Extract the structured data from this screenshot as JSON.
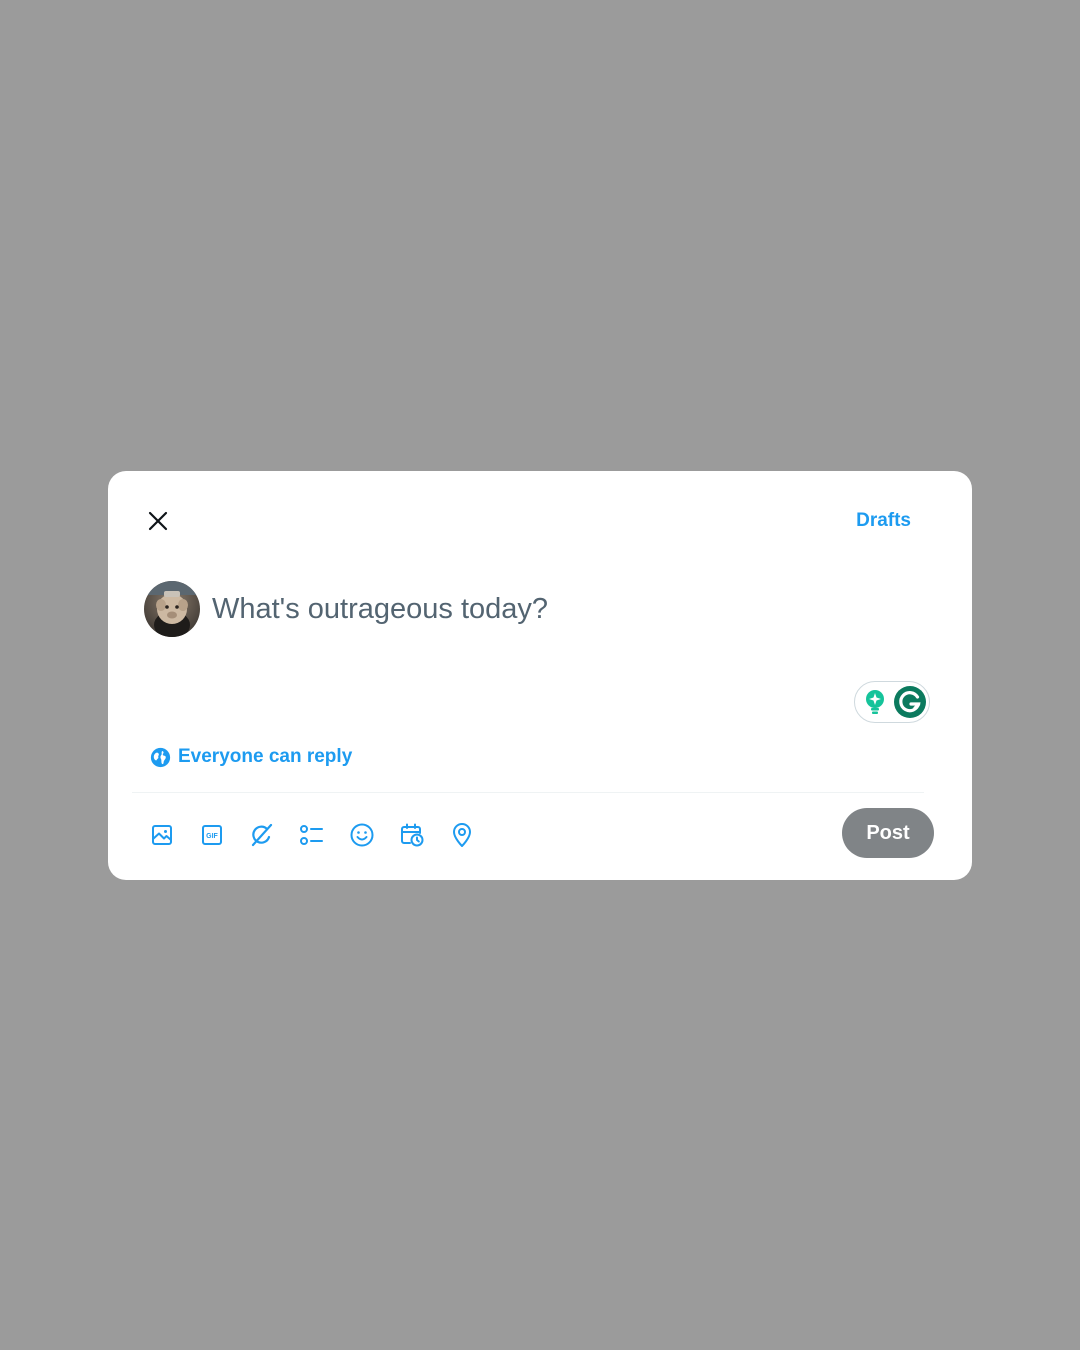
{
  "header": {
    "close_icon": "close-icon",
    "drafts_label": "Drafts"
  },
  "composer": {
    "avatar_icon": "user-avatar",
    "placeholder": "What's outrageous today?",
    "value": "",
    "grammarly_icons": [
      "lightbulb-icon",
      "grammarly-g-icon"
    ]
  },
  "reply_setting": {
    "icon": "globe-icon",
    "label": "Everyone can reply"
  },
  "toolbar": {
    "tools": [
      "image-icon",
      "gif-icon",
      "grok-icon",
      "poll-icon",
      "emoji-icon",
      "schedule-icon",
      "location-icon"
    ]
  },
  "post_button": {
    "label": "Post",
    "state": "disabled"
  },
  "colors": {
    "backdrop": "#9b9b9b",
    "accent": "#1d9bf0",
    "placeholder_text": "#536471",
    "post_disabled": "#808487",
    "grammarly_green": "#15c39a",
    "grammarly_dark": "#0b7a5e"
  }
}
